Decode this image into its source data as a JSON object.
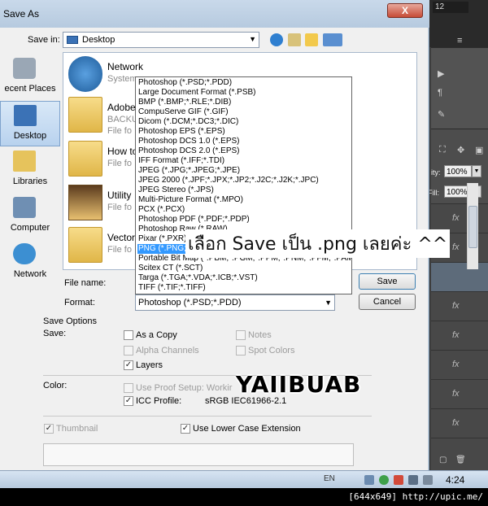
{
  "dialog": {
    "title": "Save As",
    "close_label": "X",
    "save_in_label": "Save in:",
    "save_in_value": "Desktop",
    "file_name_label": "File name:",
    "format_label": "Format:",
    "format_value": "Photoshop (*.PSD;*.PDD)",
    "save_button": "Save",
    "cancel_button": "Cancel"
  },
  "places": [
    {
      "label": "ecent Places",
      "icon": "recent-places-icon"
    },
    {
      "label": "Desktop",
      "icon": "desktop-icon"
    },
    {
      "label": "Libraries",
      "icon": "libraries-icon"
    },
    {
      "label": "Computer",
      "icon": "computer-icon"
    },
    {
      "label": "Network",
      "icon": "network-icon"
    }
  ],
  "files": [
    {
      "name": "Network",
      "sub": "System"
    },
    {
      "name": "Adobe",
      "sub": "BACKU"
    },
    {
      "name": "",
      "sub": "File fo"
    },
    {
      "name": "How to",
      "sub": "File fo"
    },
    {
      "name": "Utility",
      "sub": "File fo"
    },
    {
      "name": "Vector",
      "sub": "File fo"
    }
  ],
  "formats": [
    "Photoshop (*.PSD;*.PDD)",
    "Large Document Format (*.PSB)",
    "BMP (*.BMP;*.RLE;*.DIB)",
    "CompuServe GIF (*.GIF)",
    "Dicom (*.DCM;*.DC3;*.DIC)",
    "Photoshop EPS (*.EPS)",
    "Photoshop DCS 1.0 (*.EPS)",
    "Photoshop DCS 2.0 (*.EPS)",
    "IFF Format (*.IFF;*.TDI)",
    "JPEG (*.JPG;*.JPEG;*.JPE)",
    "JPEG 2000 (*.JPF;*.JPX;*.JP2;*.J2C;*.J2K;*.JPC)",
    "JPEG Stereo (*.JPS)",
    "Multi-Picture Format (*.MPO)",
    "PCX (*.PCX)",
    "Photoshop PDF (*.PDF;*.PDP)",
    "Photoshop Raw (*.RAW)",
    "Pixar (*.PXR)",
    "PNG (*.PNG;*.PNS)",
    "Portable Bit Map (*.PBM;*.PGM;*.PPM;*.PNM;*.PFM;*.PAM)",
    "Scitex CT (*.SCT)",
    "Targa (*.TGA;*.VDA;*.ICB;*.VST)",
    "TIFF (*.TIF;*.TIFF)"
  ],
  "selected_format_index": 17,
  "options": {
    "title": "Save Options",
    "save_label": "Save:",
    "as_copy": "As a Copy",
    "notes": "Notes",
    "alpha_channels": "Alpha Channels",
    "spot_colors": "Spot Colors",
    "layers": "Layers",
    "color_label": "Color:",
    "use_proof": "Use Proof Setup:  Workir",
    "icc_profile": "ICC Profile:",
    "icc_value": "sRGB IEC61966-2.1",
    "thumbnail": "Thumbnail",
    "lower_case": "Use Lower Case Extension"
  },
  "overlay": {
    "annotation": "เลือก Save เป็น .png เลยค่ะ ^^",
    "watermark": "YAIIBUAB"
  },
  "photoshop": {
    "zoom": "12",
    "opacity_label": "ity:",
    "opacity": "100%",
    "fill_label": "Fill:",
    "fill": "100%",
    "fx": "fx"
  },
  "taskbar": {
    "lang": "EN",
    "clock": "4:24"
  },
  "footer": "[644x649] http://upic.me/",
  "colors": {
    "selection": "#3399ff",
    "title_bar": "#c9d9ea",
    "close_button": "#c64b36"
  }
}
